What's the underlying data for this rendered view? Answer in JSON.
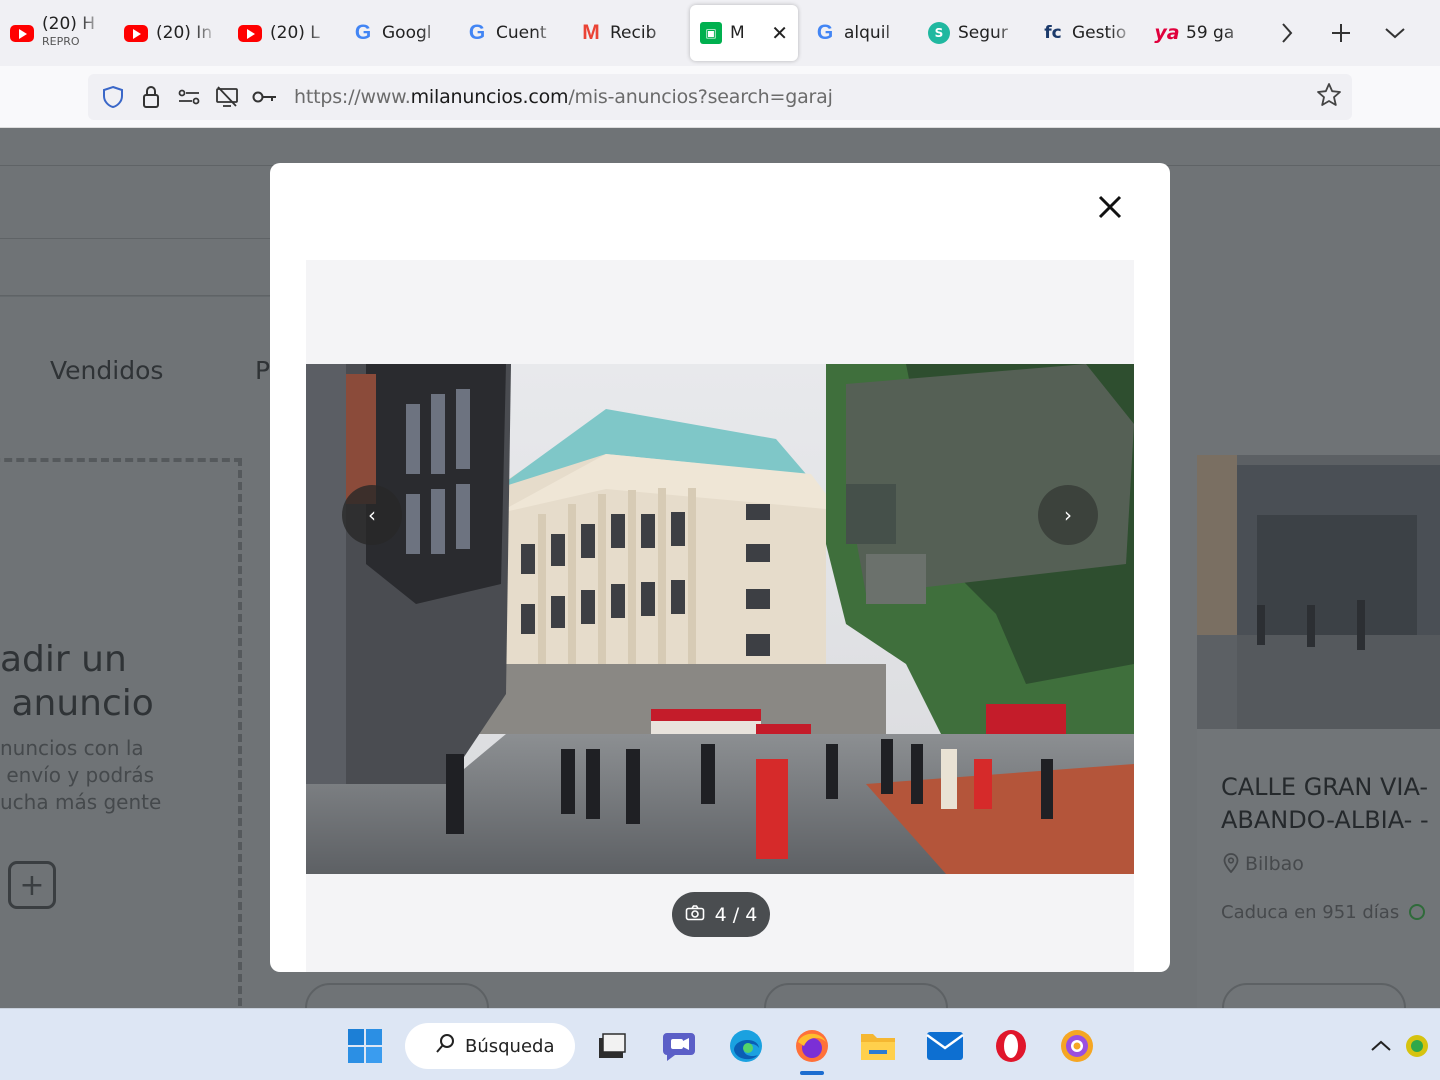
{
  "browser": {
    "tabs": [
      {
        "title": "(20) H",
        "subtitle": "REPRO",
        "icon": "youtube-icon"
      },
      {
        "title": "(20) In",
        "icon": "youtube-icon"
      },
      {
        "title": "(20) L",
        "icon": "youtube-icon"
      },
      {
        "title": "Googl",
        "icon": "google-icon"
      },
      {
        "title": "Cuent",
        "icon": "google-icon"
      },
      {
        "title": "Recib",
        "icon": "gmail-icon"
      },
      {
        "title": "M",
        "icon": "milanuncios-icon",
        "active": true
      },
      {
        "title": "alquil",
        "icon": "google-icon"
      },
      {
        "title": "Segur",
        "icon": "seguro-icon"
      },
      {
        "title": "Gestio",
        "icon": "fc-icon"
      },
      {
        "title": "59 ga",
        "icon": "ya-icon"
      }
    ],
    "tab_close_glyph": "✕",
    "url_prefix": "https://www.",
    "url_domain": "milanuncios.com",
    "url_path": "/mis-anuncios?search=garaj"
  },
  "page": {
    "tab_sold": "Vendidos",
    "tab_partial": "P",
    "add_title": "adir un\n anuncio",
    "add_text": "nuncios con la\n envío y podrás\nucha más gente",
    "card": {
      "title": "CALLE GRAN VIA-\nABANDO-ALBIA- -",
      "location": "Bilbao",
      "expires": "Caduca en 951 días"
    }
  },
  "modal": {
    "close_glyph": "✕",
    "prev_glyph": "‹",
    "next_glyph": "›",
    "counter_current": "4",
    "counter_total": "4",
    "counter_text": "4 / 4"
  },
  "taskbar": {
    "search_label": "Búsqueda"
  }
}
